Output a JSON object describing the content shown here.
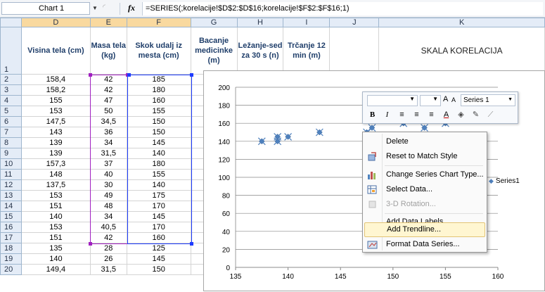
{
  "formula_bar": {
    "name_box": "Chart 1",
    "fx_label": "fx",
    "formula": "=SERIES(;korelacije!$D$2:$D$16;korelacije!$F$2:$F$16;1)"
  },
  "columns": [
    "D",
    "E",
    "F",
    "G",
    "H",
    "I",
    "J",
    "K"
  ],
  "rows": [
    "1",
    "2",
    "3",
    "4",
    "5",
    "6",
    "7",
    "8",
    "9",
    "10",
    "11",
    "12",
    "13",
    "14",
    "15",
    "16",
    "17",
    "18",
    "19",
    "20"
  ],
  "headers": {
    "d": "Visina tela (cm)",
    "e": "Masa tela (kg)",
    "f": "Skok udalj iz mesta (cm)",
    "g": "Bacanje medicinke (m)",
    "h": "Ležanje-sed za 30 s (n)",
    "i": "Trčanje 12 min (m)",
    "k": "SKALA KORELACIJA"
  },
  "data_rows": [
    {
      "d": "158,4",
      "e": "42",
      "f": "185"
    },
    {
      "d": "158,2",
      "e": "42",
      "f": "180"
    },
    {
      "d": "155",
      "e": "47",
      "f": "160"
    },
    {
      "d": "153",
      "e": "50",
      "f": "155"
    },
    {
      "d": "147,5",
      "e": "34,5",
      "f": "150"
    },
    {
      "d": "143",
      "e": "36",
      "f": "150"
    },
    {
      "d": "139",
      "e": "34",
      "f": "145"
    },
    {
      "d": "139",
      "e": "31,5",
      "f": "140"
    },
    {
      "d": "157,3",
      "e": "37",
      "f": "180"
    },
    {
      "d": "148",
      "e": "40",
      "f": "155"
    },
    {
      "d": "137,5",
      "e": "30",
      "f": "140"
    },
    {
      "d": "153",
      "e": "49",
      "f": "175"
    },
    {
      "d": "151",
      "e": "48",
      "f": "170"
    },
    {
      "d": "140",
      "e": "34",
      "f": "145"
    },
    {
      "d": "153",
      "e": "40,5",
      "f": "170"
    },
    {
      "d": "151",
      "e": "42",
      "f": "160"
    },
    {
      "d": "135",
      "e": "28",
      "f": "125"
    },
    {
      "d": "140",
      "e": "26",
      "f": "145"
    },
    {
      "d": "149,4",
      "e": "31,5",
      "f": "150"
    }
  ],
  "chart_data": {
    "type": "scatter",
    "title": "",
    "xlabel": "",
    "ylabel": "",
    "xlim": [
      135,
      160
    ],
    "ylim": [
      0,
      200
    ],
    "x_ticks": [
      135,
      140,
      145,
      150,
      155,
      160
    ],
    "y_ticks": [
      0,
      20,
      40,
      60,
      80,
      100,
      120,
      140,
      160,
      180,
      200
    ],
    "grid": "horizontal",
    "legend_position": "right",
    "series": [
      {
        "name": "Series1",
        "x": [
          137.5,
          139,
          139,
          140,
          143,
          147.5,
          148,
          151,
          153,
          155,
          153,
          151,
          157.3,
          158.2,
          158.4
        ],
        "y": [
          140,
          145,
          140,
          145,
          150,
          150,
          155,
          170,
          175,
          160,
          155,
          160,
          180,
          180,
          185
        ]
      }
    ],
    "color": "#4f81bd"
  },
  "mini_toolbar": {
    "series_selector": "Series 1",
    "grow_font": "A",
    "shrink_font": "A",
    "bold": "B",
    "italic": "I"
  },
  "context_menu": {
    "items": [
      {
        "label": "Delete",
        "icon": "",
        "disabled": false
      },
      {
        "label": "Reset to Match Style",
        "icon": "reset-style-icon",
        "disabled": false
      },
      {
        "label": "Change Series Chart Type...",
        "icon": "chart-type-icon",
        "disabled": false
      },
      {
        "label": "Select Data...",
        "icon": "select-data-icon",
        "disabled": false
      },
      {
        "label": "3-D Rotation...",
        "icon": "rotation-3d-icon",
        "disabled": true
      },
      {
        "label": "Add Data Labels",
        "icon": "",
        "disabled": false
      },
      {
        "label": "Add Trendline...",
        "icon": "",
        "disabled": false,
        "highlighted": true
      },
      {
        "label": "Format Data Series...",
        "icon": "format-series-icon",
        "disabled": false
      }
    ]
  }
}
